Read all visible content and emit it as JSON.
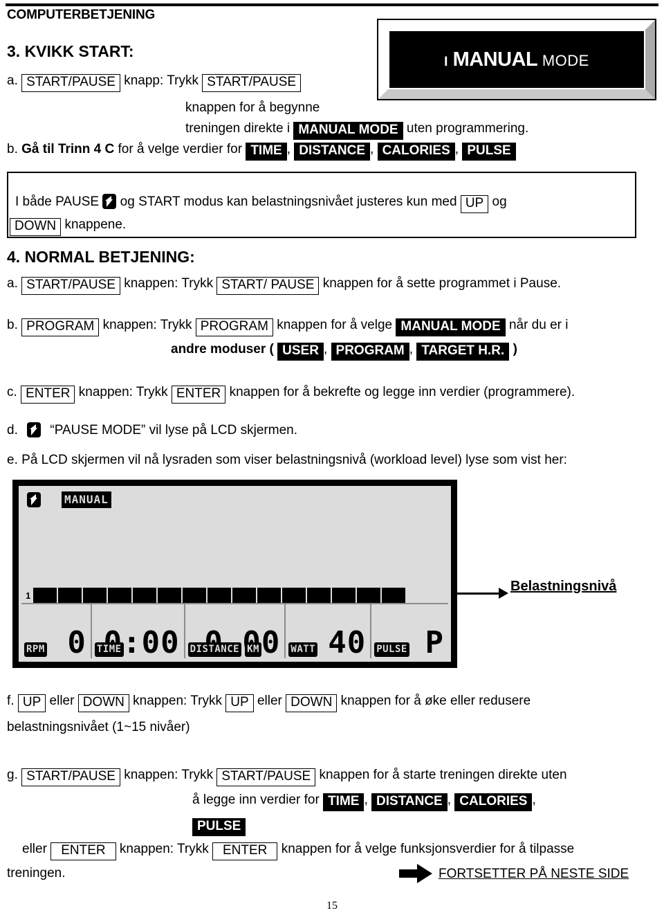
{
  "header": {
    "title": "COMPUTERBETJENING"
  },
  "mode_display": {
    "prefix": "I",
    "emphasis": "MANUAL",
    "suffix": "MODE"
  },
  "section3": {
    "heading": "3. KVIKK START:",
    "a": {
      "marker": "a.",
      "key1": "START/PAUSE",
      "mid": "knapp: Trykk",
      "key2": "START/PAUSE",
      "line2": "knappen for å begynne",
      "line3_pre": "treningen direkte i",
      "line3_chip": "MANUAL MODE",
      "line3_post": "uten programmering."
    },
    "b": {
      "marker": "b.",
      "pre": "Gå til",
      "bold": "Trinn 4 C",
      "mid": "for å velge verdier for",
      "chips": [
        "TIME",
        "DISTANCE",
        "CALORIES",
        "PULSE"
      ],
      "comma": ","
    }
  },
  "note_box": {
    "line1_pre": "I både PAUSE",
    "icon": "pause-p-icon",
    "line1_mid": "og START modus kan belastningsnivået justeres kun med",
    "key_up": "UP",
    "line1_post": "og",
    "key_down": "DOWN",
    "line2_post": "knappene."
  },
  "section4": {
    "heading": "4. NORMAL BETJENING:",
    "a": {
      "marker": "a.",
      "key1": "START/PAUSE",
      "mid": "knappen: Trykk",
      "key2": "START/ PAUSE",
      "post": "knappen for å sette programmet i Pause."
    },
    "b": {
      "marker": "b.",
      "key1": "PROGRAM",
      "mid": "knappen: Trykk",
      "key2": "PROGRAM",
      "mid2": "knappen for å velge",
      "chip": "MANUAL MODE",
      "post": "når du er i",
      "line2_pre": "andre moduser (",
      "line2_chips": [
        "USER",
        "PROGRAM",
        "TARGET H.R."
      ],
      "line2_post": ")",
      "comma": ","
    },
    "c": {
      "marker": "c.",
      "key1": "ENTER",
      "mid": "knappen: Trykk",
      "key2": "ENTER",
      "post": "knappen for å bekrefte og legge inn verdier (programmere)."
    },
    "d": {
      "marker": "d.",
      "icon": "pause-p-icon",
      "text": "“PAUSE MODE” vil lyse på LCD skjermen."
    },
    "e": {
      "marker": "e.",
      "text": "På LCD skjermen vil nå lysraden som viser belastningsnivå (workload level) lyse som vist her:"
    },
    "f": {
      "marker": "f.",
      "key1": "UP",
      "mid1": "eller",
      "key2": "DOWN",
      "mid2": "knappen: Trykk",
      "key3": "UP",
      "mid3": "eller",
      "key4": "DOWN",
      "post": "knappen for å øke eller redusere",
      "line2": "belastningsnivået (1~15 nivåer)"
    },
    "g": {
      "marker": "g.",
      "key1": "START/PAUSE",
      "mid": "knappen: Trykk",
      "key2": "START/PAUSE",
      "post": "knappen for å starte treningen direkte uten",
      "line2_pre": "å legge inn verdier for",
      "line2_chips": [
        "TIME",
        "DISTANCE",
        "CALORIES"
      ],
      "line3_chip": "PULSE",
      "comma": ",",
      "line4_pre": "eller",
      "key3": "ENTER",
      "line4_mid": "knappen: Trykk",
      "key4": "ENTER",
      "line4_post": "knappen for å velge funksjonsverdier for å tilpasse",
      "line5": "treningen."
    }
  },
  "lcd": {
    "mode_icon": "pause-p-icon",
    "mode_tag": "MANUAL",
    "workload_level_label": "1",
    "workload_segments": 15,
    "readouts": [
      {
        "value": "0",
        "tags": [
          "RPM"
        ]
      },
      {
        "value": "0:00",
        "tags": [
          "TIME"
        ]
      },
      {
        "value": "0.00",
        "tags": [
          "DISTANCE",
          "KM"
        ]
      },
      {
        "value": "40",
        "tags": [
          "WATT"
        ]
      },
      {
        "value": "P",
        "tags": [
          "PULSE"
        ]
      }
    ],
    "callout_label": "Belastningsnivå"
  },
  "footer": {
    "continue_text": "FORTSETTER PÅ NESTE SIDE",
    "arrow_icon": "right-arrow-icon",
    "page_number": "15"
  }
}
